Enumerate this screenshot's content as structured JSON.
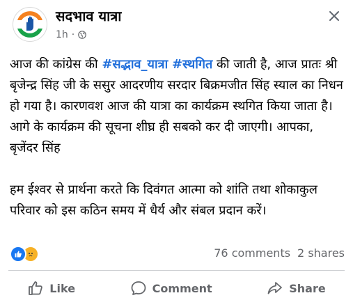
{
  "post": {
    "page_name": "सदभाव यात्रा",
    "time": "1h",
    "separator": "·",
    "text": {
      "p1_pre": "आज की कांग्रेस की ",
      "hashtag1": "#सद्भाव_यात्रा",
      "p1_space": " ",
      "hashtag2": "#स्थगित",
      "p1_post": " की जाती है, आज प्रातः श्री बृजेन्द्र सिंह जी के ससुर आदरणीय सरदार बिक्रमजीत सिंह स्याल का निधन हो गया है। कारणवश आज की यात्रा का कार्यक्रम स्थगित किया जाता है। आगे के कार्यक्रम की सूचना शीघ्र ही सबको कर दी जाएगी। आपका, बृजेंदर सिंह",
      "p2": "हम ईश्वर से प्रार्थना करते कि दिवंगत आत्मा को शांति तथा शोकाकुल परिवार को इस कठिन समय में धैर्य और संबल प्रदान करें।"
    },
    "comments": "76 comments",
    "shares": "2 shares"
  },
  "actions": {
    "like": "Like",
    "comment": "Comment",
    "share": "Share"
  },
  "colors": {
    "hashtag": "#216fdb",
    "like_blue": "#1877f2",
    "sad_yellow": "#f7b125",
    "secondary_text": "#65676b"
  }
}
